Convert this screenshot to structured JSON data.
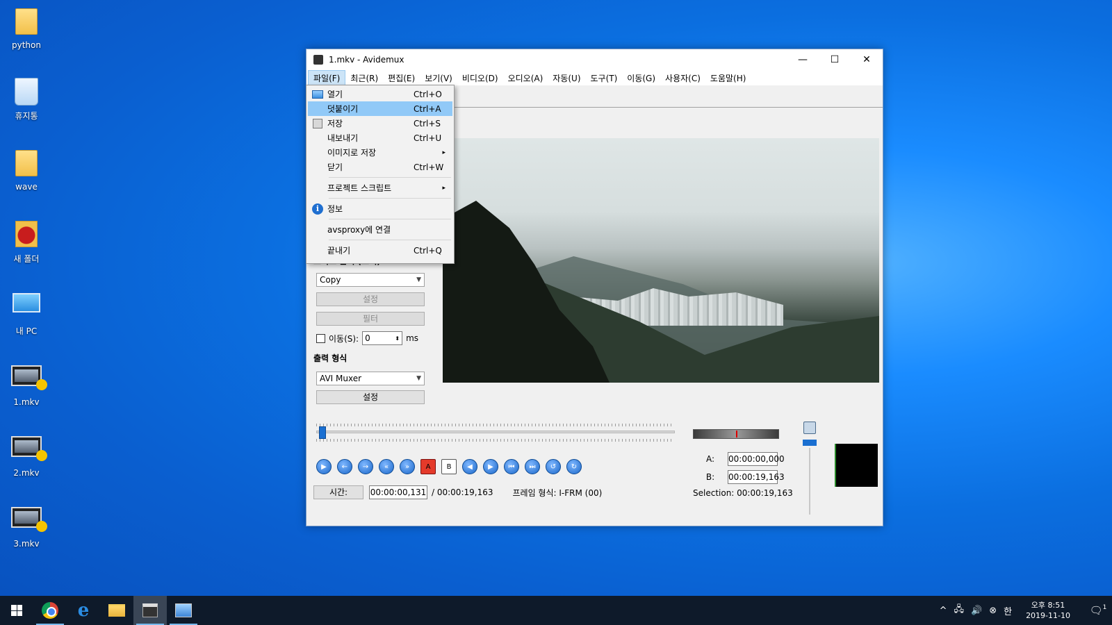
{
  "desktop": {
    "icons": [
      {
        "label": "python",
        "icon": "folder-icon"
      },
      {
        "label": "휴지통",
        "icon": "recycle-bin-icon"
      },
      {
        "label": "wave",
        "icon": "folder-icon"
      },
      {
        "label": "새 폴더",
        "icon": "folder-icon"
      },
      {
        "label": "내 PC",
        "icon": "computer-icon"
      },
      {
        "label": "1.mkv",
        "icon": "video-file-icon"
      },
      {
        "label": "2.mkv",
        "icon": "video-file-icon"
      },
      {
        "label": "3.mkv",
        "icon": "video-file-icon"
      }
    ]
  },
  "window": {
    "title": "1.mkv - Avidemux",
    "controls": {
      "minimize": "—",
      "maximize": "☐",
      "close": "✕"
    }
  },
  "menubar": [
    {
      "label": "파일(F)",
      "active": true
    },
    {
      "label": "최근(R)"
    },
    {
      "label": "편집(E)"
    },
    {
      "label": "보기(V)"
    },
    {
      "label": "비디오(D)"
    },
    {
      "label": "오디오(A)"
    },
    {
      "label": "자동(U)"
    },
    {
      "label": "도구(T)"
    },
    {
      "label": "이동(G)"
    },
    {
      "label": "사용자(C)"
    },
    {
      "label": "도움말(H)"
    }
  ],
  "file_menu": {
    "items": [
      {
        "label": "열기",
        "shortcut": "Ctrl+O",
        "icon": "open-icon"
      },
      {
        "label": "덧붙이기",
        "shortcut": "Ctrl+A",
        "highlighted": true
      },
      {
        "label": "저장",
        "shortcut": "Ctrl+S",
        "icon": "save-icon"
      },
      {
        "label": "내보내기",
        "shortcut": "Ctrl+U"
      },
      {
        "label": "이미지로 저장",
        "shortcut": "",
        "submenu": true
      },
      {
        "label": "닫기",
        "shortcut": "Ctrl+W"
      },
      {
        "label": "프로젝트 스크립트",
        "shortcut": "",
        "submenu": true
      },
      {
        "label": "정보",
        "shortcut": "",
        "icon": "info-icon"
      },
      {
        "label": "avsproxy에 연결",
        "shortcut": ""
      },
      {
        "label": "끝내기",
        "shortcut": "Ctrl+Q"
      }
    ],
    "submenu_arrow": "▸",
    "info_glyph": "i"
  },
  "left_panel": {
    "audio_output_label": "오디오 출력 (트랙)",
    "audio_codec": "Copy",
    "audio_settings_button": "설정",
    "filter_button": "필터",
    "shift_label": "이동(S):",
    "shift_value": "0",
    "shift_unit": "ms",
    "output_format_label": "출력 형식",
    "muxer": "AVI Muxer",
    "muxer_settings_button": "설정"
  },
  "playback": {
    "position_fraction": 0.007,
    "time_button": "시간:",
    "current_time": "00:00:00,131",
    "total_time": "/ 00:00:19,163",
    "frame_type": "프레임 형식: I-FRM (00)"
  },
  "markers": {
    "a_label": "A:",
    "a_value": "00:00:00,000",
    "b_label": "B:",
    "b_value": "00:00:19,163",
    "selection": "Selection: 00:00:19,163"
  },
  "taskbar": {
    "apps": [
      "start-icon",
      "chrome-icon",
      "edge-icon",
      "file-explorer-icon",
      "avidemux-icon",
      "app-icon"
    ],
    "tray": {
      "ime": "한",
      "time": "오후 8:51",
      "date": "2019-11-10",
      "notifications": "1"
    }
  }
}
